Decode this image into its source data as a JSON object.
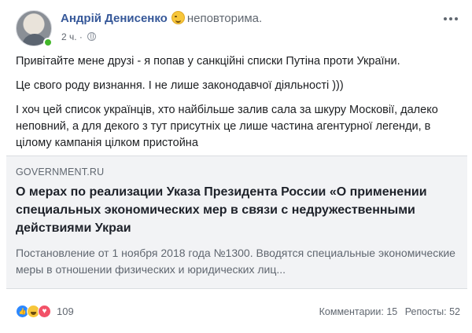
{
  "post": {
    "author": "Андрій Денисенко",
    "feeling": "неповторима.",
    "time": "2 ч.",
    "paragraphs": [
      "Привітайте мене друзі - я попав у санкційні списки Путіна проти України.",
      "Це свого роду визнання. І не лише законодавчої діяльності )))",
      "І хоч цей список українців, хто найбільше залив сала за шкуру Московії, далеко неповний, а для декого з тут присутніх це лише частина агентурної легенди, в цілому кампанія цілком пристойна"
    ]
  },
  "link_preview": {
    "domain": "GOVERNMENT.RU",
    "title": "О мерах по реализации Указа Президента России «О применении специальных экономических мер в связи с недружественными действиями Украи",
    "description": "Постановление от 1 ноября 2018 года №1300. Вводятся специальные экономические меры в отношении физических и юридических лиц..."
  },
  "footer": {
    "reaction_count": "109",
    "comments": "Комментарии: 15",
    "shares": "Репосты: 52"
  },
  "icons": {
    "avatar": "avatar",
    "feeling": "smiling-face-icon",
    "privacy": "globe-icon",
    "more": "more-options-icon",
    "reactions": [
      "like-icon",
      "haha-icon",
      "love-icon"
    ]
  },
  "colors": {
    "author": "#365899",
    "online": "#42b72a",
    "link_card_bg": "#f2f3f5",
    "like": "#2d88ff",
    "love": "#f25268"
  }
}
